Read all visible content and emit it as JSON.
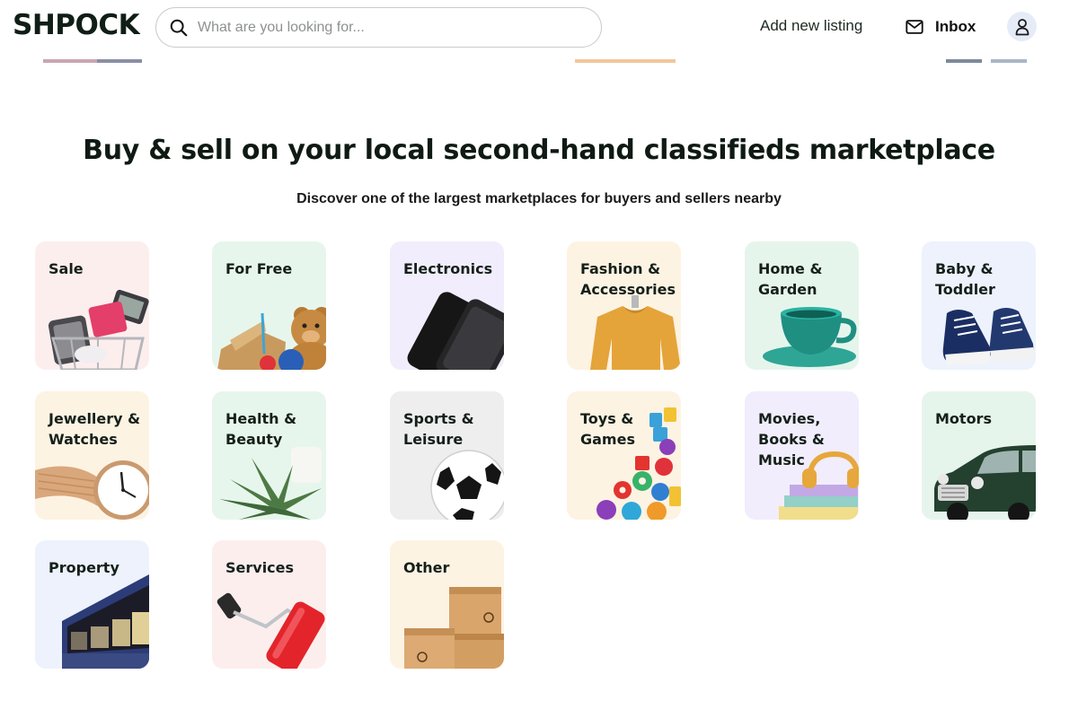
{
  "header": {
    "logo": "SHPOCK",
    "search_placeholder": "What are you looking for...",
    "add_listing": "Add new listing",
    "inbox": "Inbox",
    "search_icon": "search-icon",
    "inbox_icon": "mail-icon",
    "avatar_icon": "user-icon"
  },
  "hero": {
    "title": "Buy & sell on your local second-hand classifieds marketplace",
    "subtitle": "Discover one of the largest marketplaces for buyers and sellers nearby"
  },
  "colors": {
    "brand_text": "#0f1e16",
    "avatar_bg": "#e6ebf8"
  },
  "categories": [
    {
      "label": "Sale",
      "bg": "#fdeeee"
    },
    {
      "label": "For Free",
      "bg": "#e7f6ec"
    },
    {
      "label": "Electronics",
      "bg": "#f1edfc"
    },
    {
      "label": "Fashion & Accessories",
      "bg": "#fdf3e3"
    },
    {
      "label": "Home & Garden",
      "bg": "#e6f5ec"
    },
    {
      "label": "Baby & Toddler",
      "bg": "#edf2fc"
    },
    {
      "label": "Jewellery & Watches",
      "bg": "#fdf3e3"
    },
    {
      "label": "Health & Beauty",
      "bg": "#e7f6ec"
    },
    {
      "label": "Sports & Leisure",
      "bg": "#eeeeee"
    },
    {
      "label": "Toys & Games",
      "bg": "#fdf3e3"
    },
    {
      "label": "Movies, Books & Music",
      "bg": "#f1edfc"
    },
    {
      "label": "Motors",
      "bg": "#e6f5ec"
    },
    {
      "label": "Property",
      "bg": "#edf2fc"
    },
    {
      "label": "Services",
      "bg": "#fdeeee"
    },
    {
      "label": "Other",
      "bg": "#fdf3e3"
    }
  ]
}
